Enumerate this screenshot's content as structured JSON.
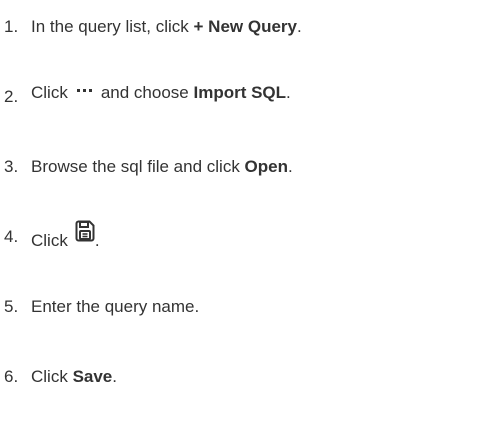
{
  "steps": [
    {
      "num": "1.",
      "pre": "In the query list, click ",
      "bold": "+ New Query",
      "post": "."
    },
    {
      "num": "2.",
      "pre": "Click",
      "mid": "and choose ",
      "bold": "Import SQL",
      "post": ".",
      "icon": "more-dots-icon"
    },
    {
      "num": "3.",
      "pre": "Browse the sql file and click ",
      "bold": "Open",
      "post": "."
    },
    {
      "num": "4.",
      "pre": "Click",
      "post": ".",
      "icon": "save-icon"
    },
    {
      "num": "5.",
      "pre": "Enter the query name."
    },
    {
      "num": "6.",
      "pre": "Click ",
      "bold": "Save",
      "post": "."
    }
  ]
}
